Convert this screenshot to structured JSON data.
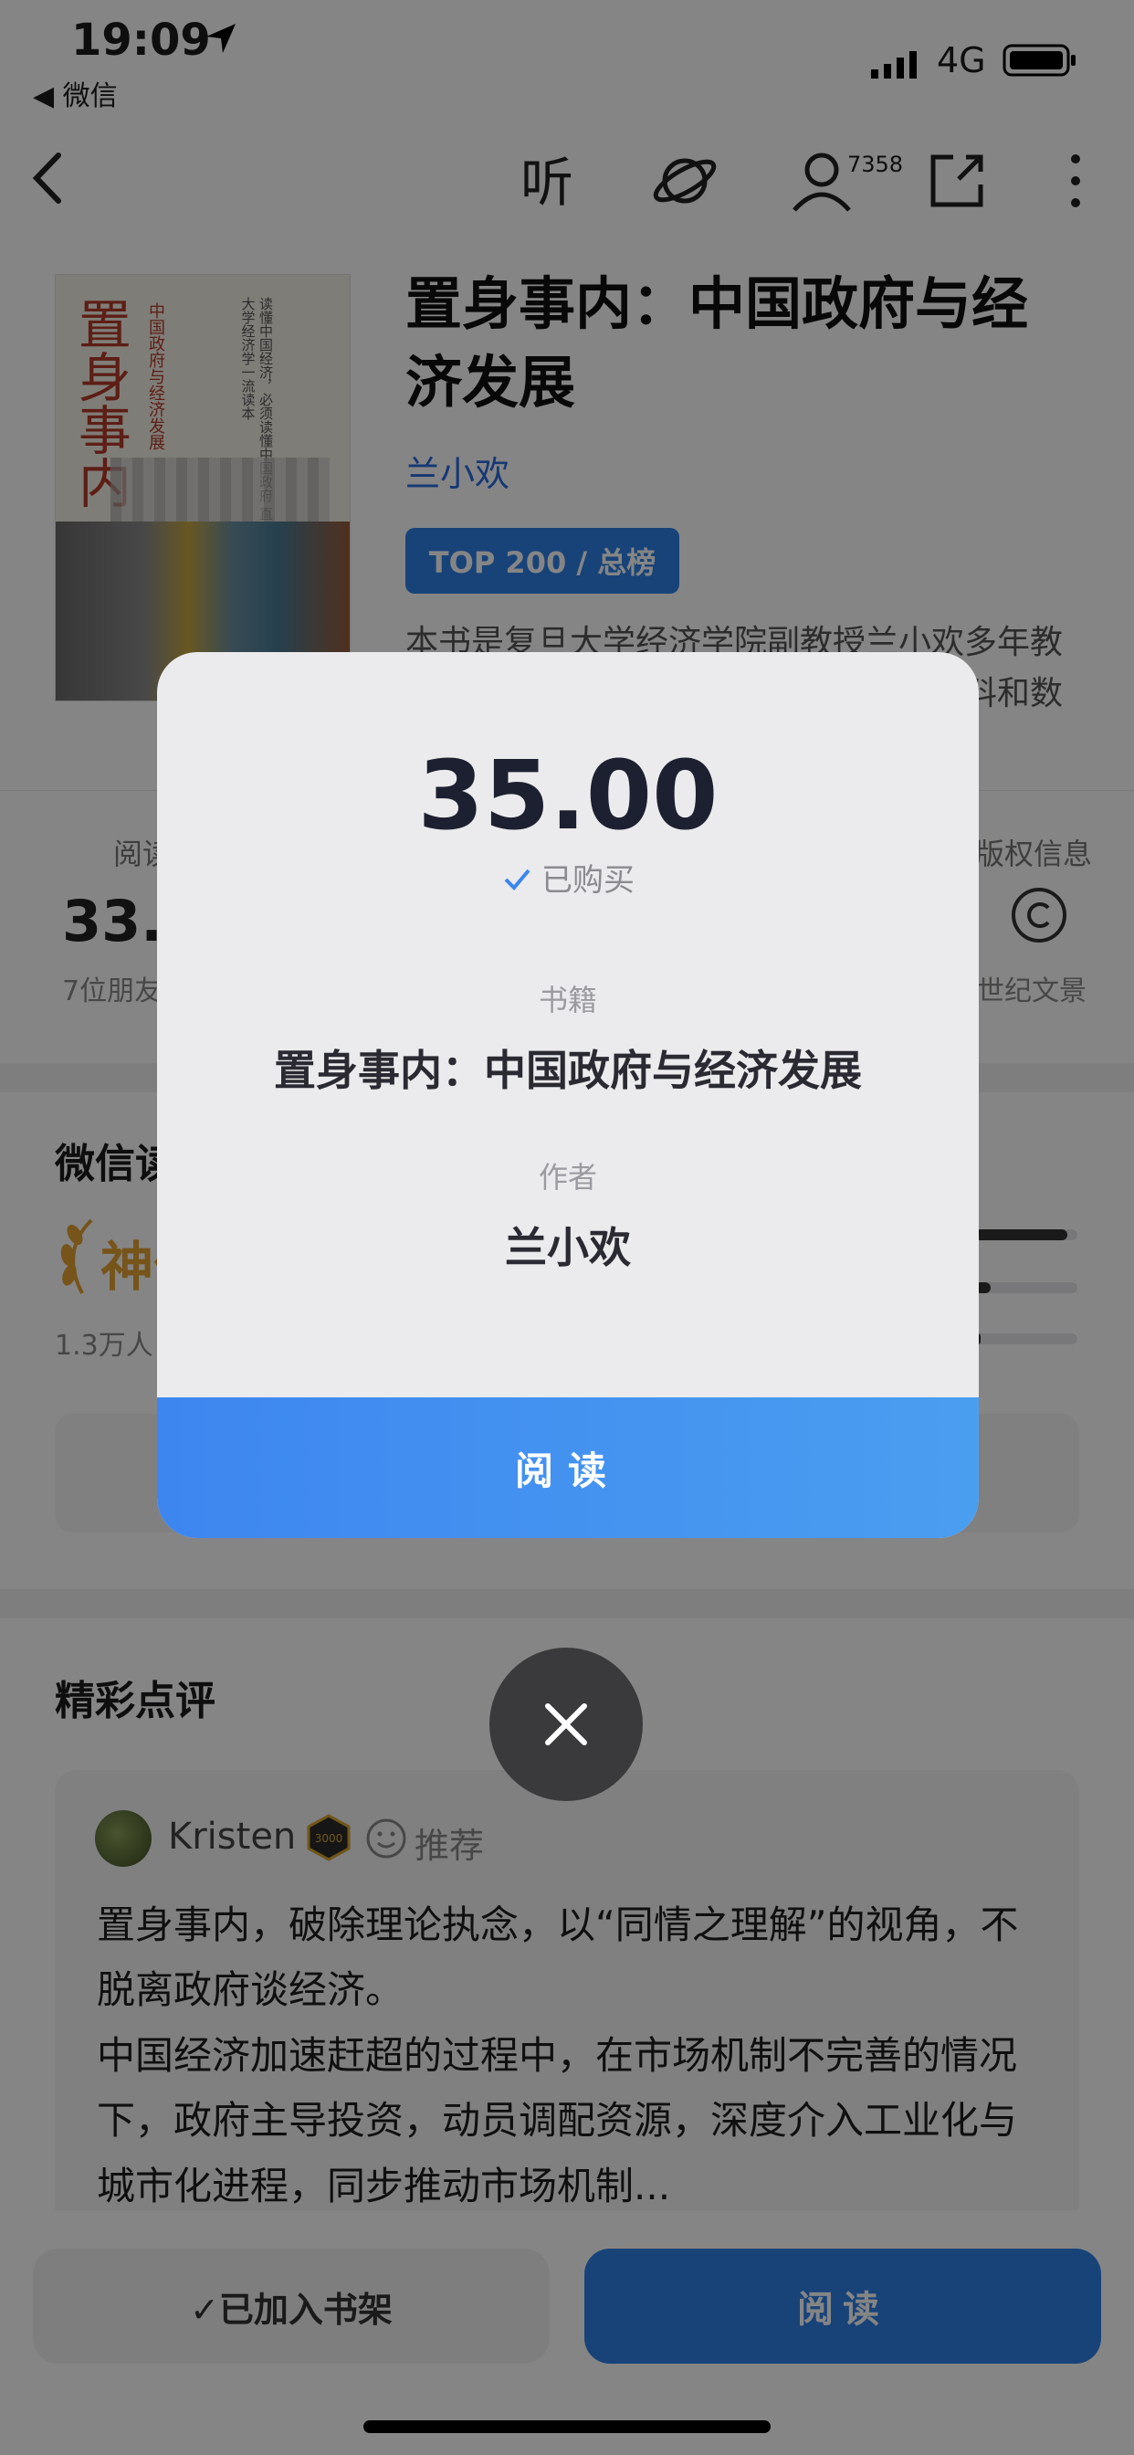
{
  "status_bar": {
    "time": "19:09",
    "back_app": "◀ 微信",
    "network": "4G"
  },
  "nav": {
    "profile_count": "7358"
  },
  "book": {
    "cover_title": "置身事内",
    "cover_subtitle": "中国政府与经济发展",
    "cover_tagline": "读懂中国经济，必须读懂中国政府 直面真问题，探究真逻辑的复旦大学经济学一流读本",
    "title": "置身事内：中国政府与经济发展",
    "author": "兰小欢",
    "rank_badge": "TOP 200 / 总榜",
    "description": "本书是复旦大学经济学院副教授兰小欢多年教学与研究的心血之作，以翔实的一手资料和数据…原…"
  },
  "stats": {
    "left_label": "阅读",
    "left_value": "33.9",
    "left_sub": "7位朋友",
    "right_label": "版权信息",
    "right_sub": "世纪文景"
  },
  "wechat_rating": {
    "title": "微信读书推荐值",
    "level": "神作",
    "count": "1.3万人",
    "bars": [
      0.9,
      0.15,
      0.05
    ]
  },
  "reviews": {
    "title": "精彩点评",
    "user": "Kristen",
    "badge": "3000",
    "recommend": "推荐",
    "text": "置身事内，破除理论执念，以“同情之理解”的视角，不脱离政府谈经济。\n中国经济加速赶超的过程中，在市场机制不完善的情况下，政府主导投资，动员调配资源，深度介入工业化与城市化进程，同步推动市场机制..."
  },
  "bottom": {
    "shelf_label": "✓已加入书架",
    "read_label": "阅读"
  },
  "dialog": {
    "price": "35.00",
    "purchased": "已购买",
    "book_label": "书籍",
    "book_value": "置身事内：中国政府与经济发展",
    "author_label": "作者",
    "author_value": "兰小欢",
    "read_button": "阅读"
  },
  "colors": {
    "accent": "#2f80e8",
    "gold": "#e3a232",
    "overlay": "rgba(0,0,0,0.48)"
  }
}
